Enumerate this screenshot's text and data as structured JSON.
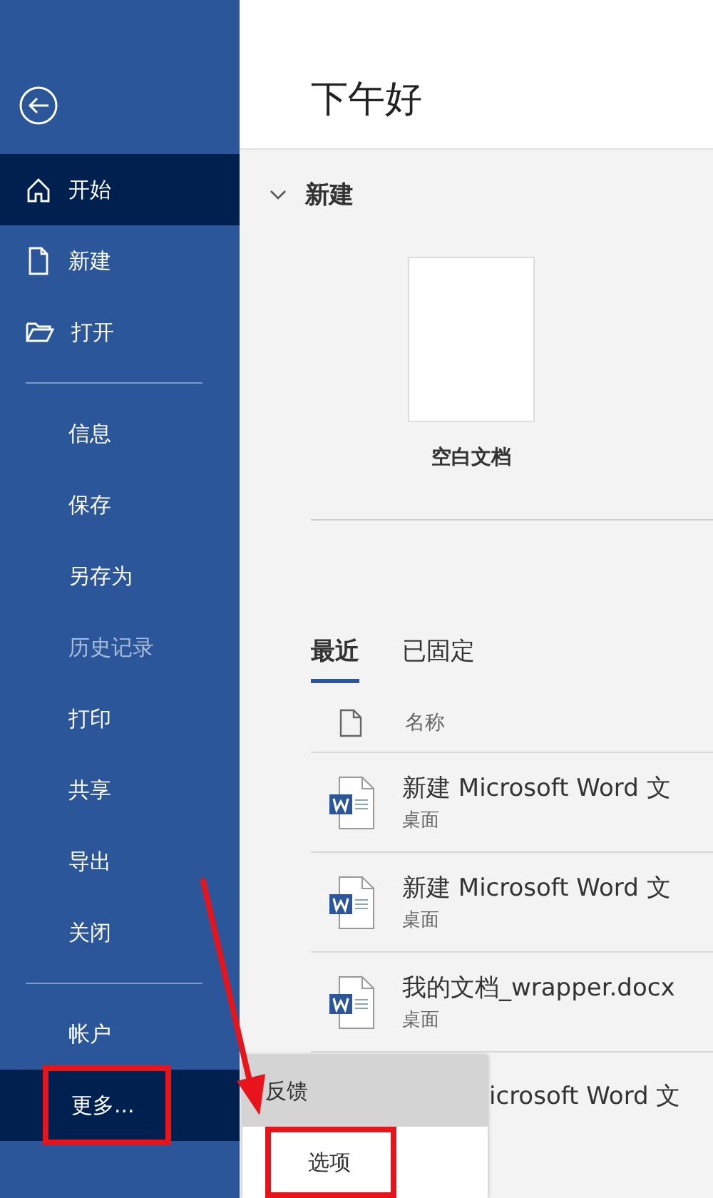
{
  "sidebar": {
    "items": [
      {
        "label": "开始",
        "kind": "icon",
        "selected": true,
        "disabled": false,
        "highlighted": false
      },
      {
        "label": "新建",
        "kind": "icon",
        "selected": false,
        "disabled": false,
        "highlighted": false
      },
      {
        "label": "打开",
        "kind": "icon",
        "selected": false,
        "disabled": false,
        "highlighted": false
      },
      {
        "kind": "divider"
      },
      {
        "label": "信息",
        "selected": false,
        "disabled": false,
        "highlighted": false
      },
      {
        "label": "保存",
        "selected": false,
        "disabled": false,
        "highlighted": false
      },
      {
        "label": "另存为",
        "selected": false,
        "disabled": false,
        "highlighted": false
      },
      {
        "label": "历史记录",
        "selected": false,
        "disabled": true,
        "highlighted": false
      },
      {
        "label": "打印",
        "selected": false,
        "disabled": false,
        "highlighted": false
      },
      {
        "label": "共享",
        "selected": false,
        "disabled": false,
        "highlighted": false
      },
      {
        "label": "导出",
        "selected": false,
        "disabled": false,
        "highlighted": false
      },
      {
        "label": "关闭",
        "selected": false,
        "disabled": false,
        "highlighted": false
      },
      {
        "kind": "divider"
      },
      {
        "label": "帐户",
        "selected": false,
        "disabled": false,
        "highlighted": false
      },
      {
        "label": "更多...",
        "selected": true,
        "disabled": false,
        "highlighted": true
      }
    ]
  },
  "greeting": "下午好",
  "new_section": {
    "title": "新建",
    "expanded": true,
    "templates": [
      {
        "label": "空白文档"
      }
    ]
  },
  "tabs": [
    {
      "label": "最近",
      "selected": true
    },
    {
      "label": "已固定",
      "selected": false
    }
  ],
  "file_list": {
    "column": "名称",
    "rows": [
      {
        "name": "新建 Microsoft Word 文",
        "location": "桌面"
      },
      {
        "name": "新建 Microsoft Word 文",
        "location": "桌面"
      },
      {
        "name": "我的文档_wrapper.docx",
        "location": "桌面"
      },
      {
        "name": "icrosoft Word 文",
        "kind": "partial"
      }
    ]
  },
  "more_menu": {
    "items": [
      {
        "label": "反馈",
        "selected": true,
        "highlighted": false
      },
      {
        "label": "选项",
        "selected": false,
        "highlighted": true
      }
    ]
  },
  "annotation_arrow": true
}
